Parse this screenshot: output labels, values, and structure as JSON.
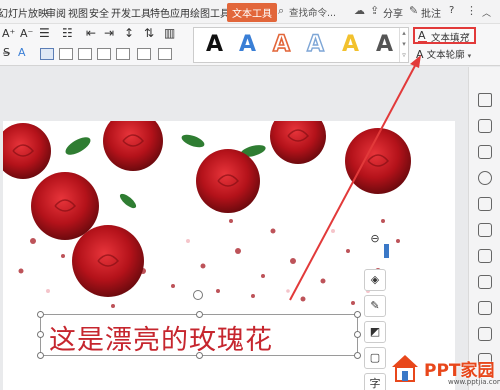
{
  "menubar": {
    "tabs": [
      "幻灯片放映",
      "审阅",
      "视图",
      "安全",
      "开发工具",
      "特色应用",
      "绘图工具"
    ],
    "active_tab": "文本工具",
    "search": "查找命令...",
    "share": "分享",
    "comment": "批注",
    "help_icon": "?"
  },
  "ribbon": {
    "art_samples": [
      {
        "glyph": "A",
        "color": "#111111",
        "style": "solid"
      },
      {
        "glyph": "A",
        "color": "#3a7fd6",
        "style": "solid"
      },
      {
        "glyph": "A",
        "color": "#e2663a",
        "style": "outline"
      },
      {
        "glyph": "A",
        "color": "#7ea6d6",
        "style": "outline"
      },
      {
        "glyph": "A",
        "color": "#f2c12e",
        "style": "solid"
      },
      {
        "glyph": "A",
        "color": "#555555",
        "style": "solid"
      }
    ],
    "text_fill": "文本填充",
    "text_outline": "文本轮廓",
    "dropdown_arrow": "▾"
  },
  "textbox": {
    "text": "这是漂亮的玫瑰花"
  },
  "minitoolbar": {
    "char_label": "字"
  },
  "watermark": {
    "brand": "PPT家园",
    "url": "www.pptjia.com"
  },
  "colors": {
    "accent": "#e2663a",
    "highlight_box": "#e23a3a",
    "text_red": "#c6262e",
    "rose_red": "#c4141b"
  }
}
